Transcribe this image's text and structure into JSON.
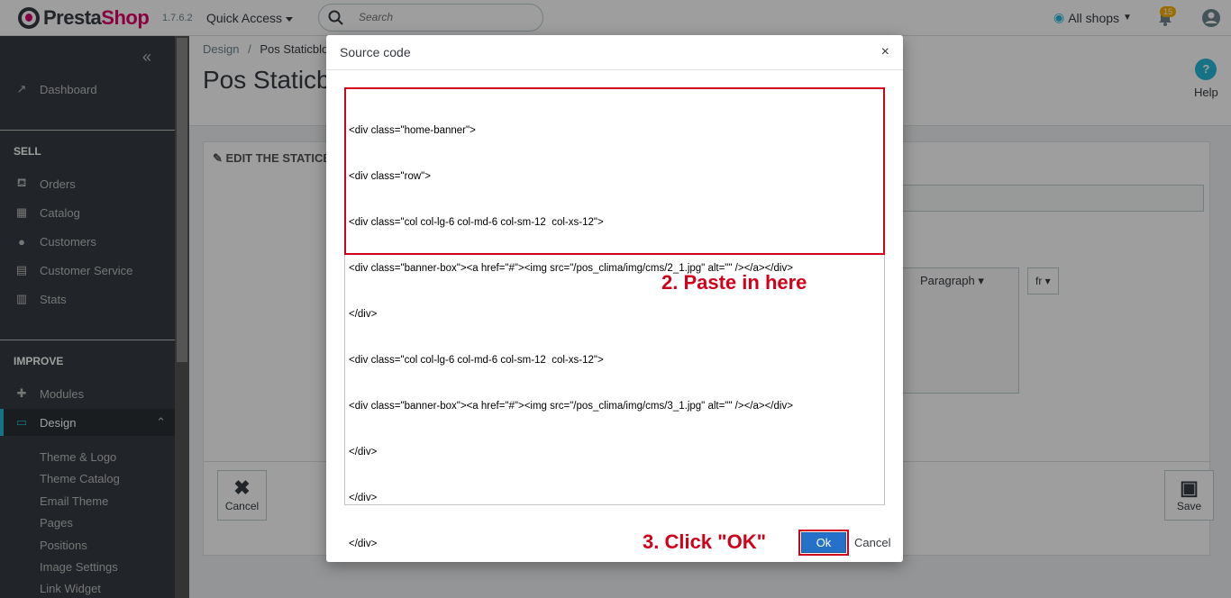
{
  "header": {
    "logo_pre": "Presta",
    "logo_post": "Shop",
    "version": "1.7.6.2",
    "quick_access": "Quick Access",
    "search_placeholder": "Search",
    "all_shops": "All shops",
    "notifications_count": "15"
  },
  "sidebar": {
    "collapse_label": "«",
    "dashboard": "Dashboard",
    "sell_title": "SELL",
    "sell_items": [
      "Orders",
      "Catalog",
      "Customers",
      "Customer Service",
      "Stats"
    ],
    "improve_title": "IMPROVE",
    "modules": "Modules",
    "design": "Design",
    "design_sub": [
      "Theme & Logo",
      "Theme Catalog",
      "Email Theme",
      "Pages",
      "Positions",
      "Image Settings",
      "Link Widget"
    ]
  },
  "main": {
    "breadcrumb_1": "Design",
    "breadcrumb_sep": "/",
    "breadcrumb_2": "Pos Staticbloc",
    "page_title": "Pos Staticb",
    "help": "Help",
    "panel_heading": "EDIT THE STATICBLOC",
    "paragraph": "Paragraph",
    "lang": "fr",
    "cancel": "Cancel",
    "save": "Save"
  },
  "modal": {
    "title": "Source code",
    "close": "×",
    "code_lines": [
      "<div class=\"home-banner\">",
      "<div class=\"row\">",
      "<div class=\"col col-lg-6 col-md-6 col-sm-12  col-xs-12\">",
      "<div class=\"banner-box\"><a href=\"#\"><img src=\"/pos_clima/img/cms/2_1.jpg\" alt=\"\" /></a></div>",
      "</div>",
      "<div class=\"col col-lg-6 col-md-6 col-sm-12  col-xs-12\">",
      "<div class=\"banner-box\"><a href=\"#\"><img src=\"/pos_clima/img/cms/3_1.jpg\" alt=\"\" /></a></div>",
      "</div>",
      "</div>",
      "</div>"
    ],
    "annotation_paste": "2. Paste in here",
    "annotation_ok": "3. Click \"OK\"",
    "ok": "Ok",
    "cancel": "Cancel"
  },
  "colors": {
    "accent": "#25b9d7",
    "brand": "#df0067",
    "annotation": "#d0021b",
    "ok_button": "#2571c9"
  }
}
